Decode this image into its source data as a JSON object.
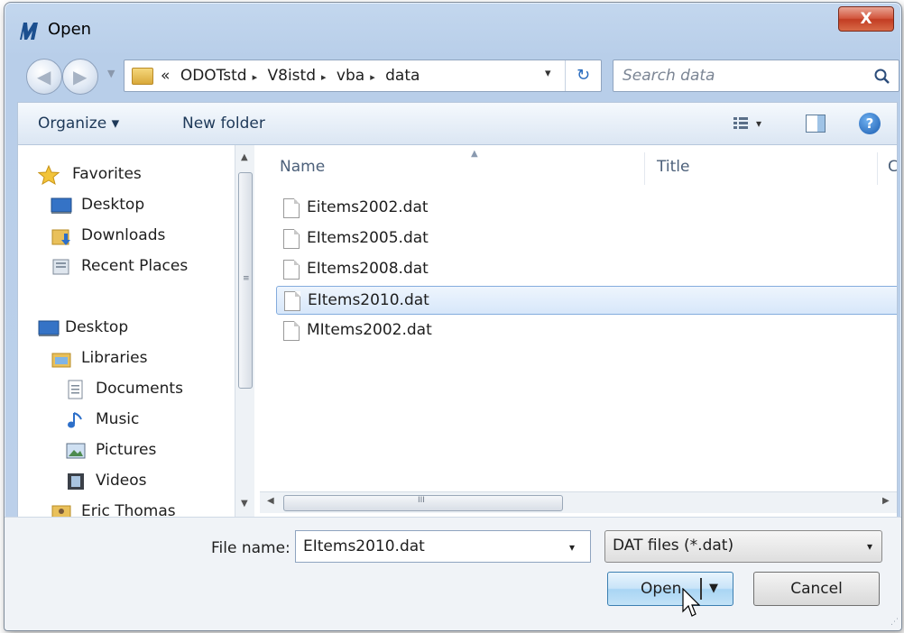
{
  "window": {
    "title": "Open",
    "close_label": "X"
  },
  "address": {
    "overflow": "«",
    "crumbs": [
      "ODOTstd",
      "V8istd",
      "vba",
      "data"
    ],
    "separator": "▸",
    "dropdown": "▾",
    "refresh": "↻"
  },
  "search": {
    "placeholder": "Search data"
  },
  "toolbar": {
    "organize": "Organize ▾",
    "new_folder": "New folder",
    "view_dropdown": "▾",
    "help": "?"
  },
  "nav": {
    "favorites": "Favorites",
    "desktop_fav": "Desktop",
    "downloads": "Downloads",
    "recent": "Recent Places",
    "desktop": "Desktop",
    "libraries": "Libraries",
    "documents": "Documents",
    "music": "Music",
    "pictures": "Pictures",
    "videos": "Videos",
    "user": "Eric Thomas"
  },
  "columns": {
    "name": "Name",
    "title": "Title",
    "third": "Co"
  },
  "files": [
    {
      "name": "Eitems2002.dat",
      "selected": false
    },
    {
      "name": "EItems2005.dat",
      "selected": false
    },
    {
      "name": "EItems2008.dat",
      "selected": false
    },
    {
      "name": "EItems2010.dat",
      "selected": true
    },
    {
      "name": "MItems2002.dat",
      "selected": false
    }
  ],
  "scroll": {
    "grip": "III",
    "v_grip": "≡"
  },
  "bottom": {
    "file_name_label": "File name:",
    "file_name_value": "EItems2010.dat",
    "file_type": "DAT files (*.dat)",
    "open_label": "Open",
    "cancel_label": "Cancel",
    "dropdown": "▾"
  }
}
